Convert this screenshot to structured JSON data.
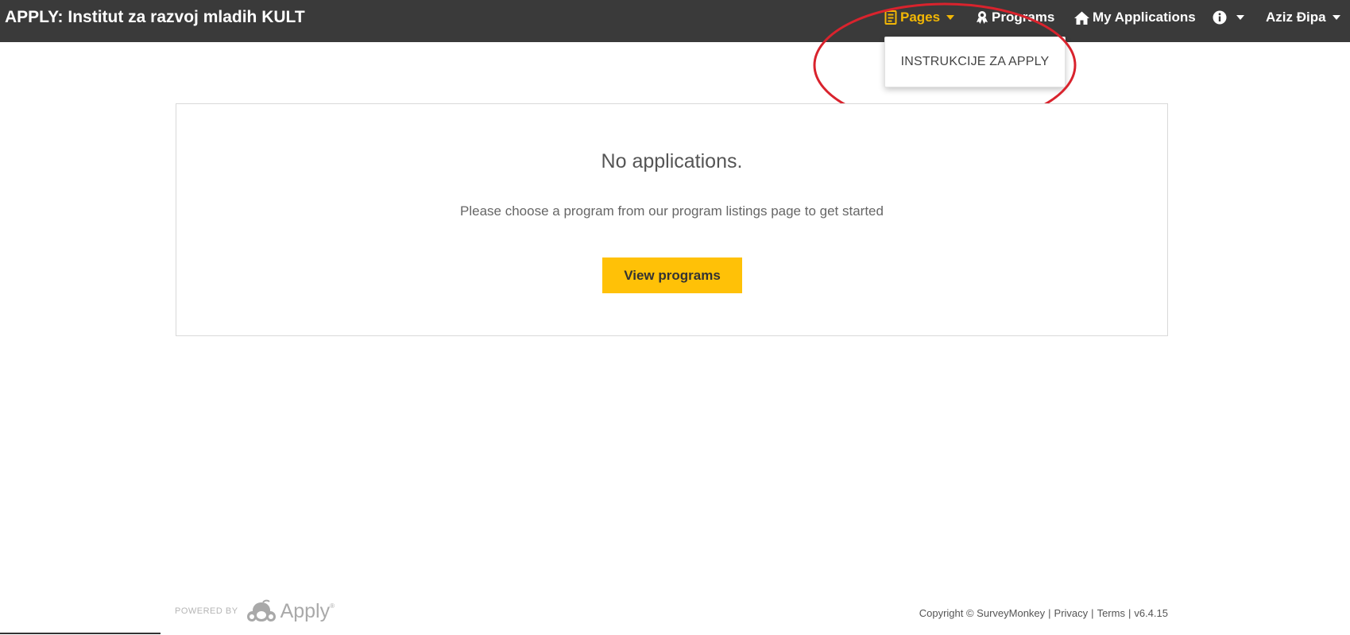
{
  "navbar": {
    "brand": "APPLY: Institut za razvoj mladih KULT",
    "pages_label": "Pages",
    "programs_label": "Programs",
    "my_applications_label": "My Applications",
    "user_name": "Aziz Đipa",
    "icons": {
      "pages": "document-icon",
      "programs": "award-ribbon-icon",
      "my_applications": "home-icon",
      "info": "info-circle-icon",
      "caret": "caret-down-icon"
    },
    "colors": {
      "background": "#3a3a3a",
      "active": "#f2b705",
      "text": "#ffffff"
    }
  },
  "pages_dropdown": {
    "items": [
      {
        "label": "INSTRUKCIJE ZA APPLY"
      }
    ]
  },
  "annotation": {
    "shape": "ellipse",
    "color": "#d9232d"
  },
  "main": {
    "title": "No applications.",
    "subtitle": "Please choose a program from our program listings page to get started",
    "button_label": "View programs",
    "button_color": "#ffc107"
  },
  "footer": {
    "powered_by": "POWERED BY",
    "logo_text": "Apply",
    "logo_tm": "®",
    "copyright": "Copyright © SurveyMonkey",
    "privacy": "Privacy",
    "terms": "Terms",
    "version": "v6.4.15",
    "separator": "|"
  }
}
